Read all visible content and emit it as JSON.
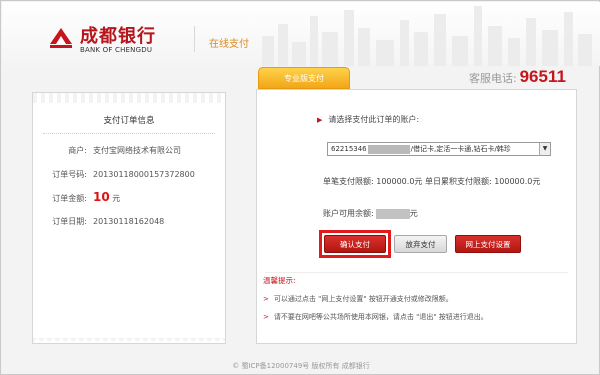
{
  "colors": {
    "brand_red": "#c5161d",
    "accent_orange": "#f2a617",
    "header_title_orange": "#d98a1e"
  },
  "header": {
    "logo_cn": "成都银行",
    "logo_en": "BANK OF CHENGDU",
    "logo_icon": "bank-logo-icon",
    "section_title": "在线支付"
  },
  "tab": {
    "label": "专业版支付"
  },
  "hotline": {
    "label": "客服电话:",
    "number": "96511"
  },
  "order": {
    "title": "支付订单信息",
    "rows": [
      {
        "label": "商户:",
        "value": "支付宝网络技术有限公司"
      },
      {
        "label": "订单号码:",
        "value": "2013011800015737280​0"
      },
      {
        "label": "订单金额:",
        "value": "10",
        "unit": "元"
      },
      {
        "label": "订单日期:",
        "value": "20130118162048"
      }
    ]
  },
  "payment": {
    "prompt": "请选择支付此订单的账户:",
    "account_prefix": "62215346",
    "account_suffix": "/借记卡,定活一卡通,钻石卡/韩珍",
    "limit_text": "单笔支付限额: 100000.0元 单日累积支付限额: 100000.0元",
    "balance_label": "账户可用余额:",
    "balance_unit": "元",
    "buttons": {
      "confirm": "确认支付",
      "cancel": "放弃支付",
      "settings": "网上支付设置"
    }
  },
  "tips": {
    "title": "温馨提示:",
    "items": [
      "可以通过点击 \"网上支付设置\" 按钮开通支付或修改限额。",
      "请不要在网吧等公共场所使用本网银，请点击 \"退出\" 按钮进行退出。"
    ]
  },
  "footer": "© 蜀ICP备12000749号 版权所有 成都银行"
}
